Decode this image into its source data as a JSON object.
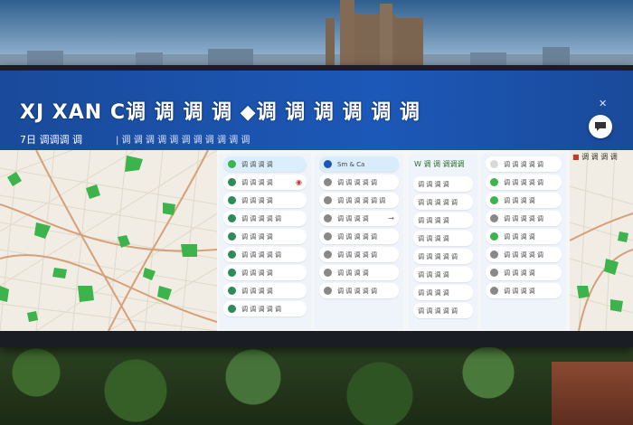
{
  "header": {
    "title": "XJ XAN С调 调 调 调 ◆调 调 调 调 调 调",
    "subtitle": "7日 调调调 调",
    "subtitle_secondary": "| 调 调 调 调 调 调 调 调 调 调 调",
    "close_mark": "✕"
  },
  "panels": {
    "panel1": {
      "rows": [
        {
          "icon": "map-pin-icon",
          "text": "调 调 调 调",
          "trail": ""
        },
        {
          "icon": "pin-icon",
          "text": "调 调 调 调",
          "trail": "◉"
        },
        {
          "icon": "pin-icon",
          "text": "调 调 调 调",
          "trail": ""
        },
        {
          "icon": "pin-icon",
          "text": "调 调 调 调 调",
          "trail": ""
        },
        {
          "icon": "pin-icon",
          "text": "调 调 调 调",
          "trail": ""
        },
        {
          "icon": "pin-icon",
          "text": "调 调 调 调 调",
          "trail": ""
        },
        {
          "icon": "pin-icon",
          "text": "调 调 调 调",
          "trail": ""
        },
        {
          "icon": "pin-icon",
          "text": "调 调 调 调",
          "trail": ""
        },
        {
          "icon": "pin-icon",
          "text": "调 调 调 调 调",
          "trail": ""
        }
      ]
    },
    "panel2": {
      "header": "Sm & Ca",
      "rows": [
        {
          "text": "调 调 调 调 调",
          "arrow": ""
        },
        {
          "text": "调 调 调 调 调 调",
          "arrow": ""
        },
        {
          "text": "调 调 调 调",
          "arrow": "→"
        },
        {
          "text": "调 调 调 调 调",
          "arrow": ""
        },
        {
          "text": "调 调 调 调 调",
          "arrow": ""
        },
        {
          "text": "调 调 调 调",
          "arrow": ""
        },
        {
          "text": "调 调 调 调 调",
          "arrow": ""
        }
      ]
    },
    "panel3": {
      "header": "W 调 调 调调调",
      "rows": [
        {
          "text": "调 调 调 调"
        },
        {
          "text": "调 调 调 调 调"
        },
        {
          "text": "调 调 调 调"
        },
        {
          "text": "调 调 调 调"
        },
        {
          "text": "调 调 调 调 调"
        },
        {
          "text": "调 调 调 调"
        },
        {
          "text": "调 调 调 调"
        },
        {
          "text": "调 调 调 调 调"
        }
      ]
    },
    "panel4": {
      "rows": [
        {
          "text": "调 调 调 调 调"
        },
        {
          "text": "调 调 调 调 调"
        },
        {
          "text": "调 调 调 调"
        },
        {
          "text": "调 调 调 调 调"
        },
        {
          "text": "调 调 调 调"
        },
        {
          "text": "调 调 调 调 调"
        },
        {
          "text": "调 调 调 调"
        },
        {
          "text": "调 调 调 调"
        }
      ]
    }
  },
  "right_map": {
    "header": "调 调 调 调"
  },
  "colors": {
    "header_blue": "#1c58b8",
    "park_green": "#3cb44b",
    "road": "#d9a47b",
    "accent_red": "#c0392b"
  }
}
